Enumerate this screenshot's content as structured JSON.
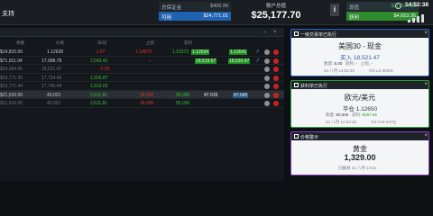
{
  "topbar": {
    "left_label": "支持",
    "account": [
      {
        "key": "总保证金",
        "value": "$406.99",
        "style": "dark"
      },
      {
        "key": "可用",
        "value": "$24,771.01",
        "style": "blue"
      }
    ],
    "equity_label": "账户总值",
    "equity_value": "$25,177.70",
    "info_icon": "i",
    "pnl": [
      {
        "key": "现值",
        "value": "$20,524.25",
        "style": "green-dark"
      },
      {
        "key": "获利",
        "value": "$4,653.35",
        "style": "green"
      }
    ],
    "time": "14:52:38"
  },
  "table": {
    "columns": [
      "余额",
      "价格",
      "日/日",
      "止损",
      "获利",
      ""
    ],
    "rows": [
      {
        "amount": "$14,810.00",
        "price": "1.12628",
        "change": "-1.97",
        "stop": "1.14878",
        "take": "1.10373",
        "bid": "1.12634",
        "ask": "1.12641",
        "style": "normal",
        "stop_color": "r",
        "take_color": "g"
      },
      {
        "amount": "$71,911.94",
        "price": "17,998.78",
        "change": "2,043.41",
        "stop": "-",
        "take": "18,519.57",
        "bid": "18,520.97",
        "ask": "",
        "style": "normal",
        "stop_color": "",
        "take_color": "g"
      },
      {
        "amount": "$24,364.06",
        "price": "18,521.47",
        "change": "-2.59",
        "stop": "-",
        "take": "-",
        "bid": "",
        "ask": "",
        "style": "dim",
        "stop_color": "",
        "take_color": ""
      },
      {
        "amount": "$23,771.43",
        "price": "17,734.45",
        "change": "1,026.87",
        "stop": "-",
        "take": "-",
        "bid": "",
        "ask": "",
        "style": "dim",
        "stop_color": "",
        "take_color": ""
      },
      {
        "amount": "$23,771.44",
        "price": "17,740.44",
        "change": "1,019.03",
        "stop": "-",
        "take": "-",
        "bid": "",
        "ask": "",
        "style": "dim",
        "stop_color": "",
        "take_color": ""
      },
      {
        "amount": "$21,510.50",
        "price": "43.021",
        "change": "2,611.81",
        "stop": "36.000",
        "take": "55.000",
        "bid": "47.015",
        "ask": "47.045",
        "style": "hl",
        "stop_color": "r",
        "take_color": "g"
      },
      {
        "amount": "$21,510.50",
        "price": "43.021",
        "change": "2,611.81",
        "stop": "36.000",
        "take": "55.000",
        "bid": "",
        "ask": "",
        "style": "dim",
        "stop_color": "r",
        "take_color": "g"
      }
    ]
  },
  "notifications": [
    {
      "header": "一级交易单已执行",
      "title": "美国30 - 现金",
      "subtitle": "买入 18,521.47",
      "line1": [
        "数量:",
        "5.00",
        "获利:",
        "-",
        "止损:",
        "-"
      ],
      "line2": "24 八月 14:52:33",
      "line3": "OS-LZ-3MZX"
    },
    {
      "header": "获利单已执行",
      "title": "欧元/美元",
      "subtitle": "平仓 1.12650",
      "line1": [
        "数量:",
        "50,000",
        "获利:",
        "$387.05"
      ],
      "line2": "24 八月 14:52:33",
      "line3": "OS-CW-247Q"
    },
    {
      "header": "价格警示",
      "title": "黄金",
      "price": "1,329.00",
      "line1": "已触发 24 八月 14:51"
    }
  ]
}
